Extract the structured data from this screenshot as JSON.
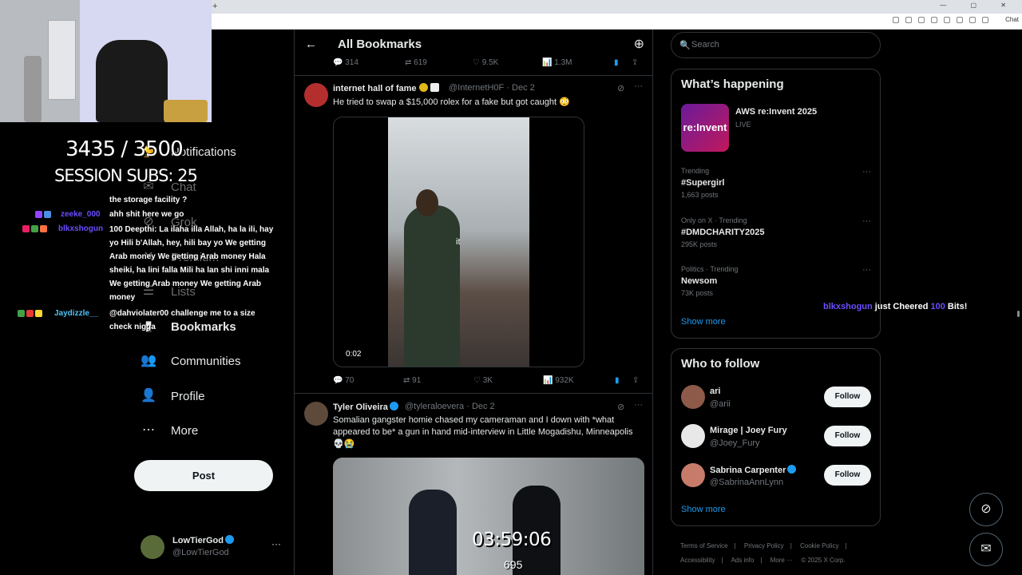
{
  "browser": {
    "new_tab": "+",
    "chat_label": "Chat"
  },
  "overlay": {
    "sub_goal": "3435 / 3500",
    "session_subs": "SESSION SUBS: 25",
    "timer": "03:59:06",
    "viewers": "695",
    "cheer": {
      "user": "blkxshogun",
      "text1": "just Cheered",
      "amount": "100",
      "text2": "Bits!"
    },
    "chat": [
      {
        "user": "",
        "text": "the storage facility ?"
      },
      {
        "user": "zeeke_000",
        "text": "ahh shit here we go"
      },
      {
        "user": "blkxshogun",
        "text": "100 Deepthi: La ilaha illa Allah, ha la ili, hay yo Hili b'Allah, hey, hili bay yo We getting Arab money We getting Arab money Hala sheiki, ha lini falla Mili ha lan shi inni mala We getting Arab money We getting Arab money"
      },
      {
        "user": "Jaydizzle__",
        "text": "@dahviolater00 challenge me to a size check nigga"
      }
    ],
    "chat_top": "the storage facility ?"
  },
  "nav": {
    "items": [
      {
        "label": "Notifications",
        "icon": "bell-icon"
      },
      {
        "label": "Chat",
        "icon": "chat-icon"
      },
      {
        "label": "Grok",
        "icon": "grok-icon"
      },
      {
        "label": "Premium",
        "icon": "x-icon"
      },
      {
        "label": "Lists",
        "icon": "list-icon"
      },
      {
        "label": "Bookmarks",
        "icon": "bookmark-icon"
      },
      {
        "label": "Communities",
        "icon": "communities-icon"
      },
      {
        "label": "Profile",
        "icon": "profile-icon"
      },
      {
        "label": "More",
        "icon": "more-icon"
      }
    ],
    "post_label": "Post",
    "account": {
      "name": "LowTierGod",
      "handle": "@LowTierGod",
      "more": "···"
    }
  },
  "main": {
    "title": "All Bookmarks",
    "back": "←",
    "prev_actions": {
      "replies": "314",
      "reposts": "619",
      "likes": "9.5K",
      "views": "1.3M"
    },
    "tweets": [
      {
        "name": "internet hall of fame",
        "handle": "@InternetH0F",
        "date": "· Dec 2",
        "text": "He tried to swap a $15,000 rolex for a fake but got caught 😳",
        "media_time": "0:02",
        "media_caption": "it",
        "replies": "70",
        "reposts": "91",
        "likes": "3K",
        "views": "932K"
      },
      {
        "name": "Tyler Oliveira",
        "handle": "@tyleraloevera",
        "date": "· Dec 2",
        "text": "Somalian gangster homie chased my cameraman and I down with *what appeared to be* a gun in hand mid-interview in Little Mogadishu, Minneapolis 💀😭"
      }
    ]
  },
  "right": {
    "search_placeholder": "Search",
    "happening": {
      "title": "What’s happening",
      "featured": {
        "thumb": "re:Invent",
        "title": "AWS re:Invent 2025",
        "status": "LIVE"
      },
      "trends": [
        {
          "context": "Trending",
          "name": "#Supergirl",
          "count": "1,663 posts"
        },
        {
          "context": "Only on X · Trending",
          "name": "#DMDCHARITY2025",
          "count": "295K posts"
        },
        {
          "context": "Politics · Trending",
          "name": "Newsom",
          "count": "73K posts"
        }
      ],
      "show_more": "Show more"
    },
    "who_to_follow": {
      "title": "Who to follow",
      "users": [
        {
          "name": "ari",
          "handle": "@arii",
          "button": "Follow"
        },
        {
          "name": "Mirage | Joey Fury",
          "handle": "@Joey_Fury",
          "button": "Follow"
        },
        {
          "name": "Sabrina Carpenter",
          "handle": "@SabrinaAnnLynn",
          "button": "Follow"
        }
      ],
      "show_more": "Show more"
    },
    "footer": [
      "Terms of Service",
      "|",
      "Privacy Policy",
      "|",
      "Cookie Policy",
      "|",
      "Accessibility",
      "|",
      "Ads info",
      "|",
      "More ···",
      "© 2025 X Corp."
    ]
  },
  "colors": {
    "accent": "#1d9bf0",
    "background": "#000000",
    "border": "#2f3336",
    "muted": "#71767b"
  }
}
